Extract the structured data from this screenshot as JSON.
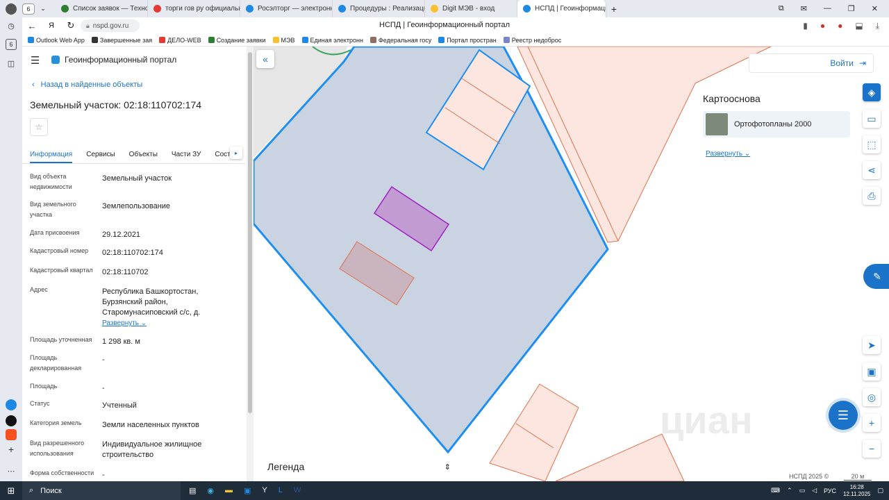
{
  "browser": {
    "tab_count": "6",
    "tabs": [
      {
        "label": "Список заявок — ТехноК",
        "color": "#2e7d32"
      },
      {
        "label": "торги гов ру официальны",
        "color": "#e53935"
      },
      {
        "label": "Росэлторг — электронная",
        "color": "#1e88e5"
      },
      {
        "label": "Процедуры : Реализация",
        "color": "#1e88e5"
      },
      {
        "label": "Digit МЭВ - вход",
        "color": "#fbc02d"
      },
      {
        "label": "НСПД | Геоинформаци",
        "color": "#1e88e5"
      }
    ],
    "url": "nspd.gov.ru",
    "page_title": "НСПД | Геоинформационный портал",
    "bookmarks": [
      "Outlook Web App",
      "Завершенные зая",
      "ДЕЛО-WEB",
      "Создание заявки",
      "МЭВ",
      "Единая электронн",
      "Федеральная госу",
      "Портал простран",
      "Реестр недоброс"
    ]
  },
  "panel": {
    "app_title": "Геоинформационный портал",
    "back_link": "Назад в найденные объекты",
    "object_title": "Земельный участок: 02:18:110702:174",
    "tabs": [
      "Информация",
      "Сервисы",
      "Объекты",
      "Части ЗУ",
      "Соста"
    ],
    "properties": [
      {
        "label": "Вид объекта недвижимости",
        "value": "Земельный участок"
      },
      {
        "label": "Вид земельного участка",
        "value": "Землепользование"
      },
      {
        "label": "Дата присвоения",
        "value": "29.12.2021"
      },
      {
        "label": "Кадастровый номер",
        "value": "02:18:110702:174"
      },
      {
        "label": "Кадастровый квартал",
        "value": "02:18:110702"
      },
      {
        "label": "Адрес",
        "value": "Республика Башкортостан, Бурзянский район, Старомунасиповский с/с, д."
      },
      {
        "label": "Площадь уточненная",
        "value": "1 298 кв. м"
      },
      {
        "label": "Площадь декларированная",
        "value": "-"
      },
      {
        "label": "Площадь",
        "value": "-"
      },
      {
        "label": "Статус",
        "value": "Учтенный"
      },
      {
        "label": "Категория земель",
        "value": "Земли населенных пунктов"
      },
      {
        "label": "Вид разрешенного использования",
        "value": "Индивидуальное жилищное строительство"
      },
      {
        "label": "Форма собственности",
        "value": "-"
      }
    ],
    "expand_link": "Развернуть"
  },
  "map": {
    "login": "Войти",
    "basemap_title": "Картооснова",
    "basemap_item": "Ортофотопланы 2000",
    "basemap_expand": "Развернуть",
    "legend": "Легенда",
    "attribution": "НСПД 2025 ©",
    "scale": "20 м",
    "watermark": "циан",
    "colors": {
      "parcel_stroke": "#1e8ff0",
      "parcel_fill": "#c9d3e2",
      "building_fill": "#c39bd3",
      "building_stroke": "#a020c0",
      "adjacent_fill": "#fde6df",
      "adjacent_stroke": "#e0704a"
    }
  },
  "taskbar": {
    "search": "Поиск",
    "lang": "РУС",
    "time": "16:28",
    "date": "12.11.2025"
  }
}
